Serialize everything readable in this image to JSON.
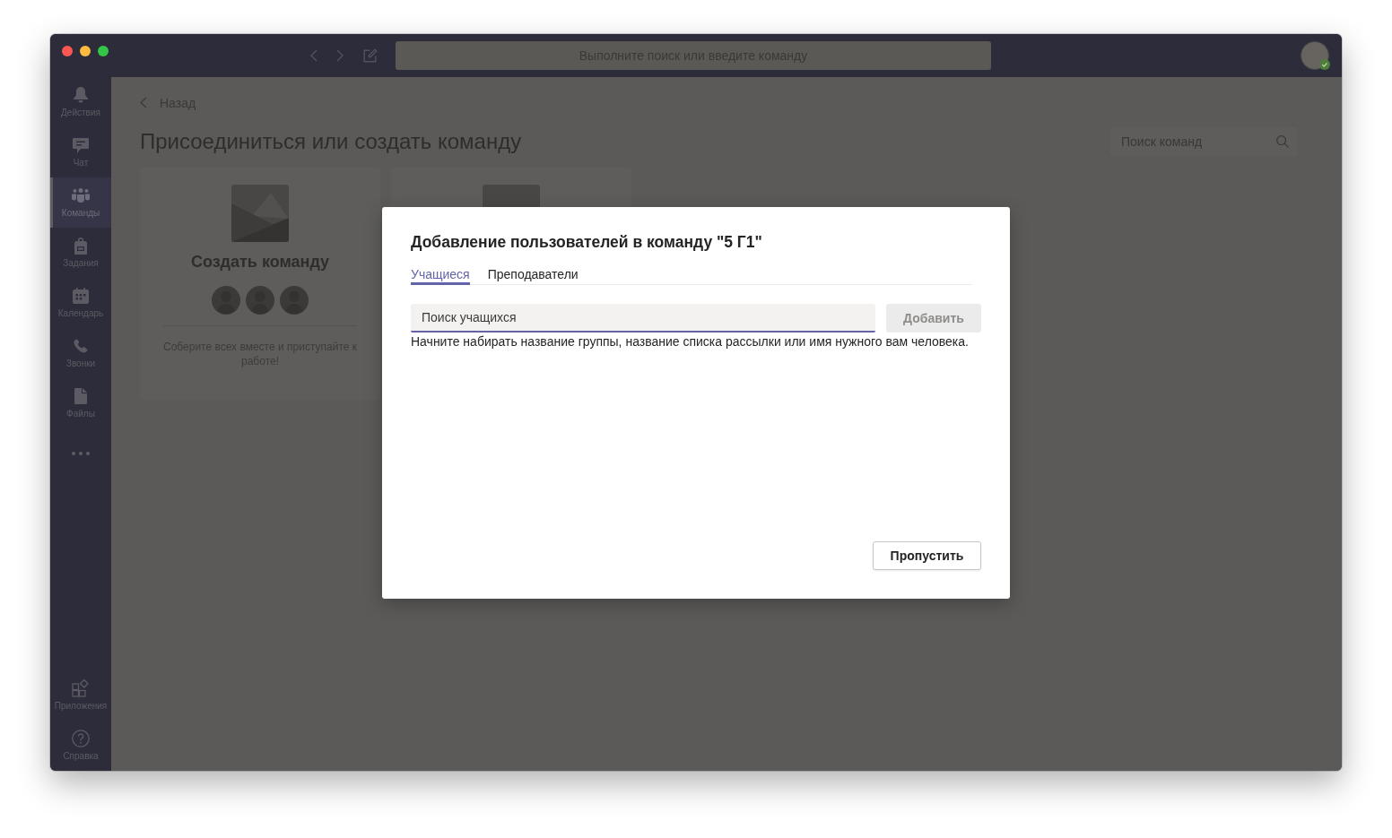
{
  "window": {
    "search": {
      "placeholder": "Выполните поиск или введите команду"
    }
  },
  "sidebar": {
    "items": [
      {
        "kind": "bell",
        "label": "Действия",
        "selected": false
      },
      {
        "kind": "chat",
        "label": "Чат",
        "selected": false
      },
      {
        "kind": "teams",
        "label": "Команды",
        "selected": true
      },
      {
        "kind": "assignments",
        "label": "Задания",
        "selected": false
      },
      {
        "kind": "calendar",
        "label": "Календарь",
        "selected": false
      },
      {
        "kind": "calls",
        "label": "Звонки",
        "selected": false
      },
      {
        "kind": "files",
        "label": "Файлы",
        "selected": false
      }
    ],
    "bottom_items": [
      {
        "kind": "apps",
        "label": "Приложения",
        "selected": false
      },
      {
        "kind": "help",
        "label": "Справка",
        "selected": false
      }
    ]
  },
  "page": {
    "back_link": "Назад",
    "title": "Присоединиться или создать команду",
    "team_search": {
      "placeholder": "Поиск команд"
    },
    "cards": [
      {
        "title": "Создать команду",
        "description": "Соберите всех вместе и приступайте к работе!"
      }
    ]
  },
  "dialog": {
    "title": "Добавление пользователей в команду \"5 Г1\"",
    "tabs": [
      {
        "label": "Учащиеся",
        "selected": true
      },
      {
        "label": "Преподаватели",
        "selected": false
      }
    ],
    "search": {
      "placeholder": "Поиск учащихся"
    },
    "add_button": {
      "label": "Добавить",
      "disabled": true
    },
    "hint": "Начните набирать название группы, название списка рассылки или имя нужного вам человека.",
    "skip_button": {
      "label": "Пропустить"
    }
  }
}
